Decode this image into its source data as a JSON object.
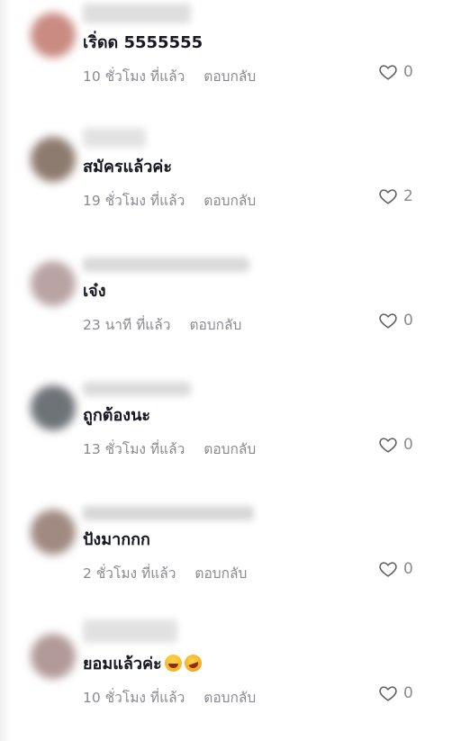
{
  "comments": [
    {
      "text": "เริ่ดด 5555555",
      "time": "10 ชั่วโมง ที่แล้ว",
      "reply": "ตอบกลับ",
      "likes": "0",
      "avatar_color": "#c98b82"
    },
    {
      "text": "สมัครแล้วค่ะ",
      "time": "19 ชั่วโมง ที่แล้ว",
      "reply": "ตอบกลับ",
      "likes": "2",
      "avatar_color": "#8e7b6f"
    },
    {
      "text": "เจ๋ง",
      "time": "23 นาที ที่แล้ว",
      "reply": "ตอบกลับ",
      "likes": "0",
      "avatar_color": "#b9a3a3"
    },
    {
      "text": "ถูกต้องนะ",
      "time": "13 ชั่วโมง ที่แล้ว",
      "reply": "ตอบกลับ",
      "likes": "0",
      "avatar_color": "#6e7378"
    },
    {
      "text": "ปังมากกก",
      "time": "2 ชั่วโมง ที่แล้ว",
      "reply": "ตอบกลับ",
      "likes": "0",
      "avatar_color": "#a08a82"
    },
    {
      "text": "ยอมแล้วค่ะ",
      "time": "10 ชั่วโมง ที่แล้ว",
      "reply": "ตอบกลับ",
      "likes": "0",
      "avatar_color": "#b29a98",
      "emojis": [
        "laughing-face-emoji",
        "rolling-laughing-emoji"
      ]
    }
  ]
}
